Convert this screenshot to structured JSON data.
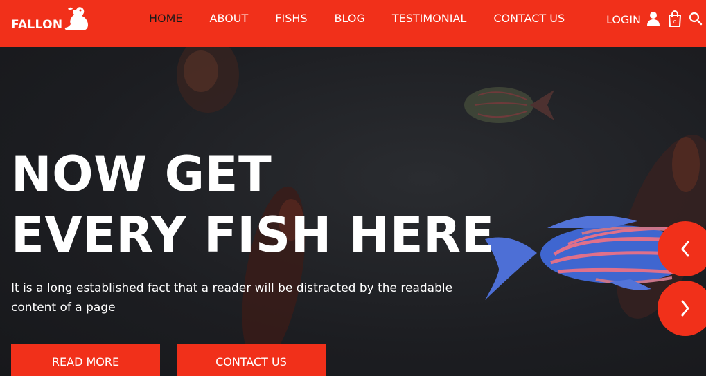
{
  "brand": {
    "name": "FALLON"
  },
  "nav": {
    "items": [
      {
        "label": "HOME",
        "active": true
      },
      {
        "label": "ABOUT"
      },
      {
        "label": "FISHS"
      },
      {
        "label": "BLOG"
      },
      {
        "label": "TESTIMONIAL"
      },
      {
        "label": "CONTACT US"
      }
    ]
  },
  "tools": {
    "login_label": "LOGIN",
    "cart_count": "0"
  },
  "hero": {
    "headline_line1": "NOW GET",
    "headline_line2": "EVERY FISH HERE",
    "subtitle": "It is a long established fact that a reader will be distracted by the readable content of a page",
    "read_more_label": "READ MORE",
    "contact_label": "CONTACT US"
  },
  "colors": {
    "accent": "#f1301a",
    "background": "#1e1f23",
    "text": "#ffffff",
    "active_nav": "#1a1a1a"
  },
  "icons": [
    "seal-logo-icon",
    "user-icon",
    "shopping-bag-icon",
    "search-icon",
    "chevron-left-icon",
    "chevron-right-icon"
  ]
}
